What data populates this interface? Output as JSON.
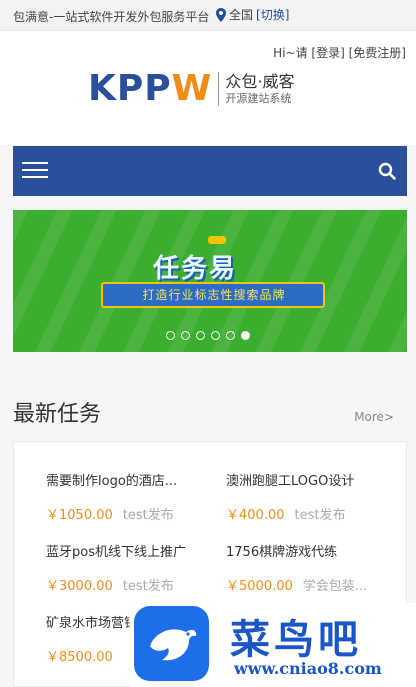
{
  "topbar": {
    "slogan": "包满意-一站式软件开发外包服务平台",
    "location": "全国",
    "switch_link": "[切换]"
  },
  "header": {
    "greeting": "Hi~请",
    "login_link": "[登录]",
    "register_link": "[免费注册]",
    "logo": {
      "mark_blue": "KPP",
      "mark_orange": "W",
      "line1": "众包·威客",
      "line2": "开源建站系统"
    }
  },
  "navbar": {
    "menu_icon": "hamburger-icon",
    "search_icon": "search-icon",
    "color": "#2a4f9b"
  },
  "banner": {
    "title": "任务易",
    "subtitle": "打造行业标志性搜索品牌",
    "dots": 6,
    "active_dot": 6,
    "background": "#3cae2f"
  },
  "section": {
    "title": "最新任务",
    "more_link": "More>"
  },
  "tasks": [
    {
      "name": "需要制作logo的酒店...",
      "price": "￥1050.00",
      "publisher": "test发布"
    },
    {
      "name": "澳洲跑腿工LOGO设计",
      "price": "￥400.00",
      "publisher": "test发布"
    },
    {
      "name": "蓝牙pos机线下线上推广",
      "price": "￥3000.00",
      "publisher": "test发布"
    },
    {
      "name": "1756棋牌游戏代练",
      "price": "￥5000.00",
      "publisher": "学会包装..."
    },
    {
      "name": "矿泉水市场营销",
      "price": "￥8500.00",
      "publisher": ""
    }
  ],
  "watermark": {
    "text": "菜鸟吧",
    "url": "www.cniao8.com"
  },
  "colors": {
    "brand_blue": "#2a4f9b",
    "accent_orange": "#f08c1a"
  }
}
